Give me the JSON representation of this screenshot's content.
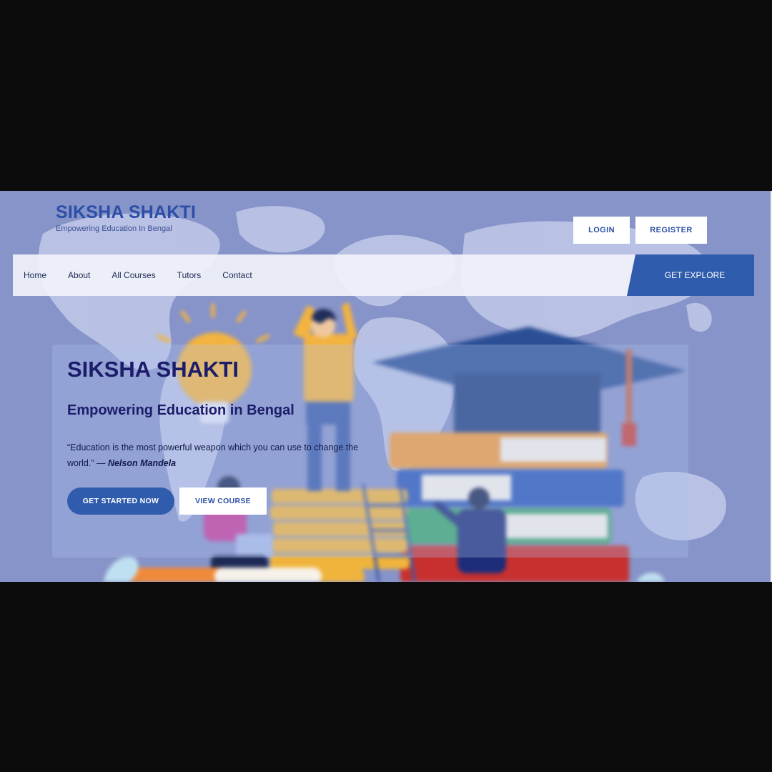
{
  "header": {
    "brand_title": "SIKSHA SHAKTI",
    "brand_tagline": "Empowering Education In Bengal",
    "login_label": "LOGIN",
    "register_label": "REGISTER"
  },
  "nav": {
    "items": [
      {
        "label": "Home"
      },
      {
        "label": "About"
      },
      {
        "label": "All Courses"
      },
      {
        "label": "Tutors"
      },
      {
        "label": "Contact"
      }
    ],
    "explore_label": "GET EXPLORE"
  },
  "hero": {
    "title": "SIKSHA SHAKTI",
    "subtitle": "Empowering Education in Bengal",
    "quote": "“Education is the most powerful weapon which you can use to change the world.” — ",
    "quote_author": "Nelson Mandela",
    "primary_cta": "GET STARTED NOW",
    "secondary_cta": "VIEW COURSE"
  },
  "icons": {
    "illustration": "education-illustration",
    "map": "world-map-illustration"
  },
  "colors": {
    "page_background": "#0c0c0c",
    "hero_background": "#8794c9",
    "brand_blue": "#2b4fa6",
    "button_blue": "#2f5cad",
    "heading_navy": "#1c1c6a"
  }
}
